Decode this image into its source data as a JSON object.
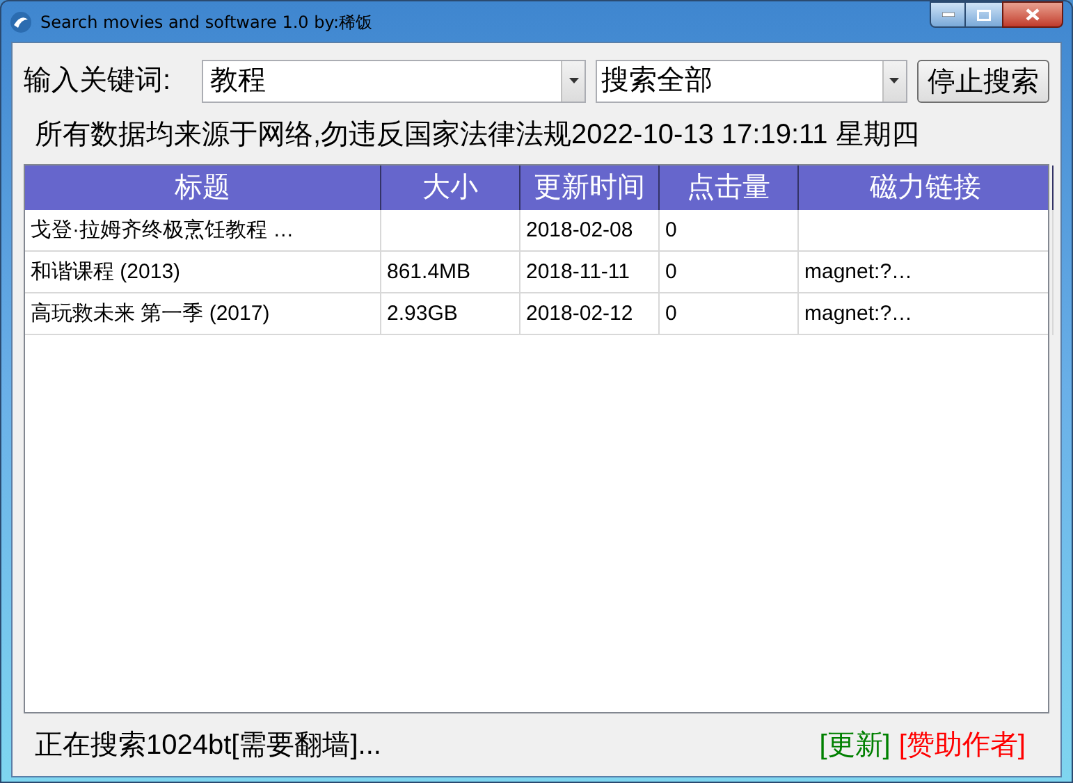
{
  "window": {
    "title": "Search movies and software 1.0 by:稀饭"
  },
  "search": {
    "label": "输入关键词:",
    "keyword": "教程",
    "scope": "搜索全部",
    "button": "停止搜索"
  },
  "notice": "所有数据均来源于网络,勿违反国家法律法规2022-10-13 17:19:11 星期四",
  "table": {
    "columns": [
      "标题",
      "大小",
      "更新时间",
      "点击量",
      "磁力链接"
    ],
    "rows": [
      [
        "戈登·拉姆齐终极烹饪教程 …",
        null,
        "2018-02-08",
        "0",
        null
      ],
      [
        "和谐课程 (2013)",
        "861.4MB",
        "2018-11-11",
        "0",
        "magnet:?…"
      ],
      [
        "高玩救未来 第一季 (2017)",
        "2.93GB",
        "2018-02-12",
        "0",
        "magnet:?…"
      ]
    ]
  },
  "status_bar": {
    "text": "正在搜索1024bt[需要翻墙]...",
    "links": [
      {
        "label": "[更新]",
        "color": "#008000"
      },
      {
        "label": "[赞助作者]",
        "color": "#ff0000"
      }
    ]
  }
}
